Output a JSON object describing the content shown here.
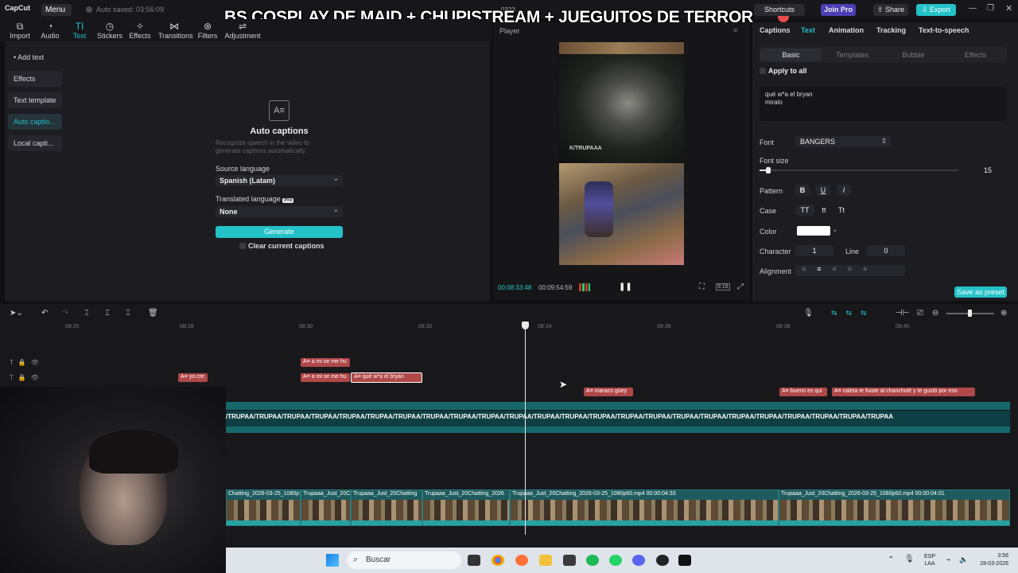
{
  "titlebar": {
    "logo": "CapCut",
    "menu": "Menu",
    "autosave": "Auto saved: 03:56:09",
    "project": "0323",
    "overlay_title": "BS COSPLAY DE MAID + CHUPISTREAM + JUEGUITOS DE TERROR",
    "shortcuts": "Shortcuts",
    "join_pro": "Join Pro",
    "share": "Share",
    "export": "Export",
    "colors": {
      "accent": "#23c2c8",
      "pro": "#4c3fb5",
      "caption": "#b04848",
      "track": "#1e5b5e"
    }
  },
  "toolbar": [
    {
      "label": "Import",
      "icon": "import-icon"
    },
    {
      "label": "Audio",
      "icon": "audio-icon"
    },
    {
      "label": "Text",
      "icon": "text-icon",
      "active": true
    },
    {
      "label": "Stickers",
      "icon": "sticker-icon"
    },
    {
      "label": "Effects",
      "icon": "effects-icon"
    },
    {
      "label": "Transitions",
      "icon": "transitions-icon"
    },
    {
      "label": "Filters",
      "icon": "filters-icon"
    },
    {
      "label": "Adjustment",
      "icon": "adjustment-icon"
    }
  ],
  "leftnav": [
    {
      "label": "• Add text"
    },
    {
      "label": "Effects"
    },
    {
      "label": "Text template"
    },
    {
      "label": "Auto captio...",
      "active": true
    },
    {
      "label": "Local capti..."
    }
  ],
  "captions_panel": {
    "icon": "captions-icon",
    "title": "Auto captions",
    "desc": "Recognize speech in the video to generate captions automatically.",
    "source_label": "Source language",
    "source_value": "Spanish (Latam)",
    "translated_label": "Translated language",
    "pro_badge": "Pro",
    "translated_value": "None",
    "generate": "Generate",
    "clear": "Clear current captions"
  },
  "player": {
    "title": "Player",
    "current_time": "00:08:33:48",
    "total_time": "00:09:54:59",
    "watermark": "K/TRUPAAA",
    "ratio": "9:16"
  },
  "right_panel": {
    "tabs": [
      "Captions",
      "Text",
      "Animation",
      "Tracking",
      "Text-to-speech"
    ],
    "subtabs": [
      "Basic",
      "Templates",
      "Bubble",
      "Effects"
    ],
    "apply_all": "Apply to all",
    "text_line1": "qué w*a el bryan",
    "text_line2": "miralo",
    "font_label": "Font",
    "font_value": "BANGERS",
    "font_size_label": "Font size",
    "font_size_value": "15",
    "font_size_fraction": 0.03,
    "pattern_label": "Pattern",
    "pattern_bold": "B",
    "pattern_underline": "U",
    "pattern_italic": "I",
    "case_label": "Case",
    "case_upper": "TT",
    "case_lower": "tt",
    "case_title": "Tt",
    "color_label": "Color",
    "color_value": "#ffffff",
    "character_label": "Character",
    "character_value": "1",
    "line_label": "Line",
    "line_value": "0",
    "alignment_label": "Alignment",
    "save_preset": "Save as preset"
  },
  "timeline": {
    "ruler": [
      "08:26",
      "08:28",
      "08:30",
      "08:32",
      "08:34",
      "08:36",
      "08:38",
      "08:40"
    ],
    "captions_row1": [
      {
        "text": "A≡ a mi se me hu"
      }
    ],
    "captions_row2": [
      {
        "text": "A≡ yo cre"
      },
      {
        "text": "A≡ a mi se me hu"
      },
      {
        "text": "A≡ qué w*a el bryan"
      }
    ],
    "captions_row3": [
      {
        "text": "A≡ maraco güey"
      },
      {
        "text": "A≡ bueno es qui"
      },
      {
        "text": "A≡ caleta te fuiste al chancholé y te gustó por eso"
      }
    ],
    "overlay_text": "/TRUPAA/TRUPAA/TRUPAA/TRUPAA/TRUPAA/TRUPAA/TRUPAA/TRUPAA/TRUPAA/TRUPAA/TRUPAA/TRUPAA/TRUPAA/TRUPAA/TRUPAA/TRUPAA/TRUPAA/TRUPAA/TRUPAA/TRUPAA/TRUPAA/TRUPAA/TRUPAA/TRUPAA",
    "clips": [
      {
        "name": "Chatting_2026-03-25_1080p"
      },
      {
        "name": "Trupaaa_Just_20C"
      },
      {
        "name": "Trupaaa_Just_20Chatting"
      },
      {
        "name": "Trupaaa_Just_20Chatting_2026"
      },
      {
        "name": "Trupaaa_Just_20Chatting_2026-03-25_1080p60.mp4  00:00:04:33"
      },
      {
        "name": "Trupaaa_Just_20Chatting_2026-03-25_1080p60.mp4  00:00:04:01"
      }
    ]
  },
  "taskbar": {
    "search": "Buscar",
    "lang1": "ESP",
    "lang2": "LAA",
    "time": "3:56",
    "date": "28-03-2026"
  }
}
